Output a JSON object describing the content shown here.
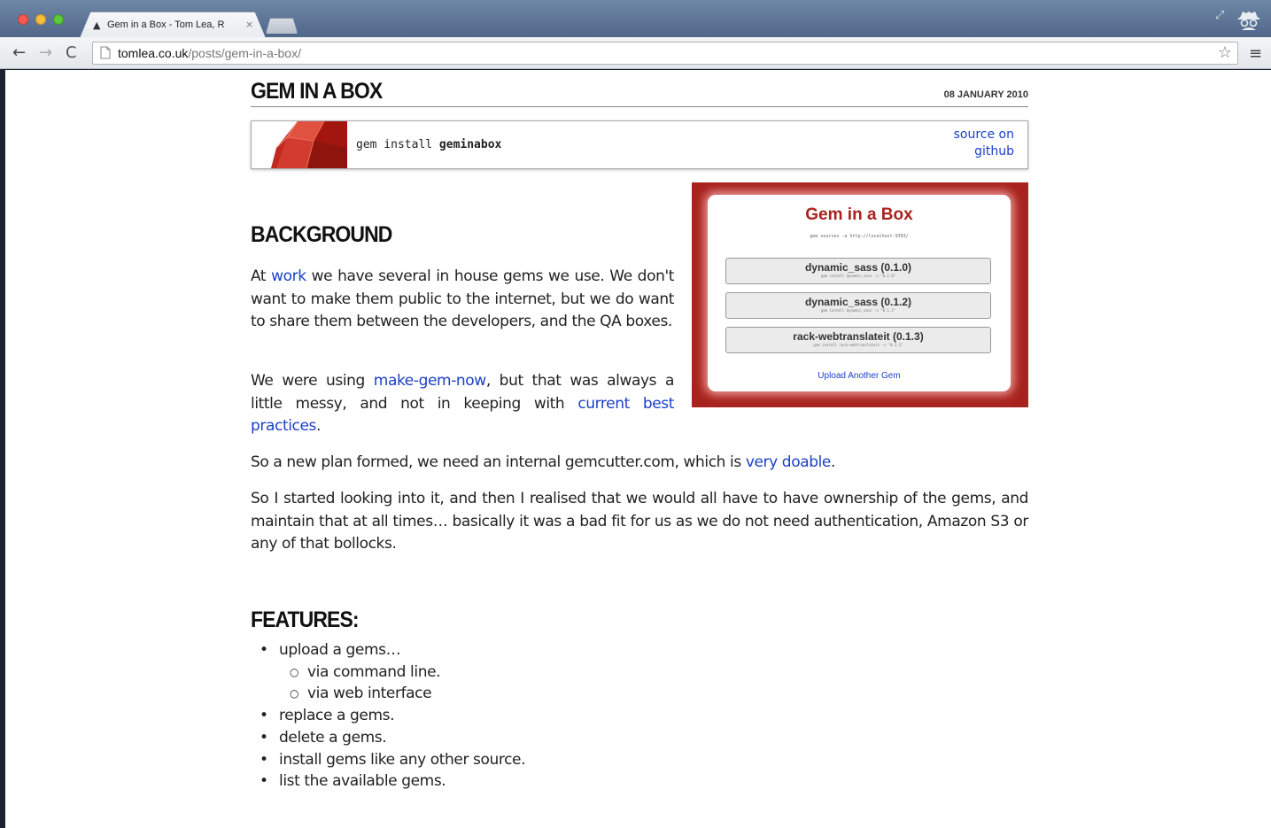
{
  "browser": {
    "tab_title": "Gem in a Box - Tom Lea, R",
    "tab_close": "×",
    "url_host": "tomlea.co.uk",
    "url_path": "/posts/gem-in-a-box/"
  },
  "icons": {
    "back": "←",
    "forward": "→",
    "reload": "C",
    "page": "📄",
    "star": "☆",
    "menu": "≡",
    "fullscreen": "⤢",
    "tab_favicon": "▲"
  },
  "post": {
    "title": "GEM IN A BOX",
    "date": "08 JANUARY 2010",
    "install_prefix": "gem install ",
    "install_gem": "geminabox",
    "source_link": "source on github"
  },
  "screenshot": {
    "title": "Gem in a Box",
    "subtitle": "gem sources -a http://localhost:9393/",
    "gems": [
      {
        "name": "dynamic_sass (0.1.0)",
        "cmd": "gem install dynamic_sass -v \"0.1.0\""
      },
      {
        "name": "dynamic_sass (0.1.2)",
        "cmd": "gem install dynamic_sass -v \"0.1.2\""
      },
      {
        "name": "rack-webtranslateit (0.1.3)",
        "cmd": "gem install rack-webtranslateit -v \"0.1.3\""
      }
    ],
    "upload_link": "Upload Another Gem"
  },
  "background": {
    "heading": "BACKGROUND",
    "p1_a": "At ",
    "p1_link": "work",
    "p1_b": " we have several in house gems we use. We don't want to make them public to the internet, but we do want to share them between the developers, and the QA boxes.",
    "p2_a": "We were using ",
    "p2_link1": "make-gem-now",
    "p2_b": ", but that was always a little messy, and not in keeping with ",
    "p2_link2": "current best practices",
    "p2_c": ".",
    "p3_a": "So a new plan formed, we need an internal gemcutter.com, which is ",
    "p3_link": "very doable",
    "p3_b": ".",
    "p4": "So I started looking into it, and then I realised that we would all have to have ownership of the gems, and maintain that at all times… basically it was a bad fit for us as we do not need authentication, Amazon S3 or any of that bollocks."
  },
  "features": {
    "heading": "FEATURES:",
    "items": [
      "upload a gems…",
      "replace a gems.",
      "delete a gems.",
      "install gems like any other source.",
      "list the available gems."
    ],
    "sub_items": [
      "via command line.",
      "via web interface"
    ]
  },
  "colors": {
    "link": "#1a3fc8",
    "ruby_red": "#a8231e"
  }
}
